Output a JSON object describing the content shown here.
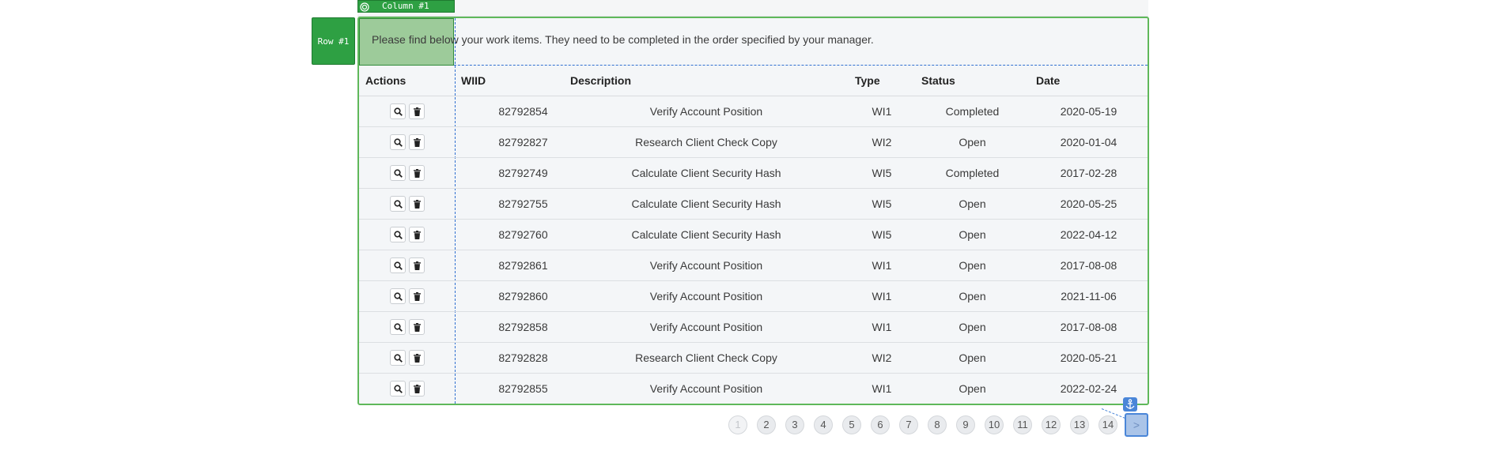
{
  "overlays": {
    "column_label": "Column #1",
    "row_label": "Row #1"
  },
  "intro": {
    "text": "Please find below your work items. They need to be completed in the order specified by your manager."
  },
  "table": {
    "headers": {
      "actions": "Actions",
      "wiid": "WIID",
      "description": "Description",
      "type": "Type",
      "status": "Status",
      "date": "Date"
    },
    "action_icons": [
      "search-icon",
      "trash-icon"
    ],
    "rows": [
      {
        "wiid": "82792854",
        "description": "Verify Account Position",
        "type": "WI1",
        "status": "Completed",
        "date": "2020-05-19"
      },
      {
        "wiid": "82792827",
        "description": "Research Client Check Copy",
        "type": "WI2",
        "status": "Open",
        "date": "2020-01-04"
      },
      {
        "wiid": "82792749",
        "description": "Calculate Client Security Hash",
        "type": "WI5",
        "status": "Completed",
        "date": "2017-02-28"
      },
      {
        "wiid": "82792755",
        "description": "Calculate Client Security Hash",
        "type": "WI5",
        "status": "Open",
        "date": "2020-05-25"
      },
      {
        "wiid": "82792760",
        "description": "Calculate Client Security Hash",
        "type": "WI5",
        "status": "Open",
        "date": "2022-04-12"
      },
      {
        "wiid": "82792861",
        "description": "Verify Account Position",
        "type": "WI1",
        "status": "Open",
        "date": "2017-08-08"
      },
      {
        "wiid": "82792860",
        "description": "Verify Account Position",
        "type": "WI1",
        "status": "Open",
        "date": "2021-11-06"
      },
      {
        "wiid": "82792858",
        "description": "Verify Account Position",
        "type": "WI1",
        "status": "Open",
        "date": "2017-08-08"
      },
      {
        "wiid": "82792828",
        "description": "Research Client Check Copy",
        "type": "WI2",
        "status": "Open",
        "date": "2020-05-21"
      },
      {
        "wiid": "82792855",
        "description": "Verify Account Position",
        "type": "WI1",
        "status": "Open",
        "date": "2022-02-24"
      }
    ]
  },
  "pagination": {
    "current_page": 1,
    "pages": [
      "1",
      "2",
      "3",
      "4",
      "5",
      "6",
      "7",
      "8",
      "9",
      "10",
      "11",
      "12",
      "13",
      "14"
    ],
    "next_label": ">"
  },
  "colors": {
    "overlay_green": "#2ea043",
    "container_border": "#5fb85a",
    "dashed_blue": "#2f6fd0",
    "next_highlight": "#4a86d8"
  }
}
